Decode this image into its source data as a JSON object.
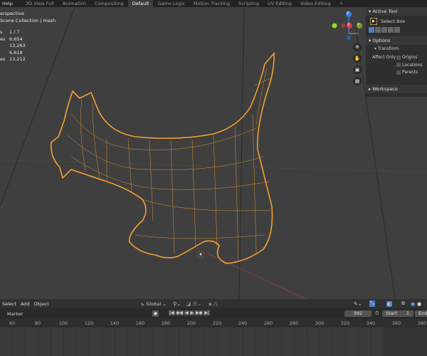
{
  "topbar": {
    "menu": "Help",
    "tabs": [
      "3D View Full",
      "Animation",
      "Compositing",
      "Default",
      "Game Logic",
      "Motion Tracking",
      "Scripting",
      "UV Editing",
      "Video Editing"
    ],
    "active_tab": "Default",
    "add_tab": "+"
  },
  "viewport": {
    "view_name": "erspective",
    "collection": "Scene Collection | mash",
    "stats": [
      {
        "k": "s",
        "v": "1 / 7"
      },
      {
        "k": "es",
        "v": "6,654"
      },
      {
        "k": "",
        "v": "13,263"
      },
      {
        "k": "",
        "v": "6,618"
      },
      {
        "k": "es",
        "v": "13,212"
      }
    ],
    "gizmo": {
      "z": "Z",
      "x": "X",
      "y": "Y"
    },
    "wire_color": "#f5a030"
  },
  "panel": {
    "active_tool": "Active Tool",
    "tool_name": "Select Box",
    "options": "Options",
    "transform": "Transform",
    "affect_only": "Affect Only",
    "checks": [
      "Origins",
      "Locations",
      "Parents"
    ],
    "workspace": "Workspace"
  },
  "view_header": {
    "menus": [
      "Select",
      "Add",
      "Object"
    ],
    "orientation": "Global"
  },
  "timeline": {
    "marker": "Marker",
    "current_frame": "392",
    "start_label": "Start",
    "start": "1",
    "end_label": "End",
    "ticks": [
      "60",
      "80",
      "100",
      "120",
      "140",
      "160",
      "180",
      "200",
      "220",
      "240",
      "260",
      "280",
      "300",
      "320",
      "340",
      "360",
      "380"
    ]
  }
}
